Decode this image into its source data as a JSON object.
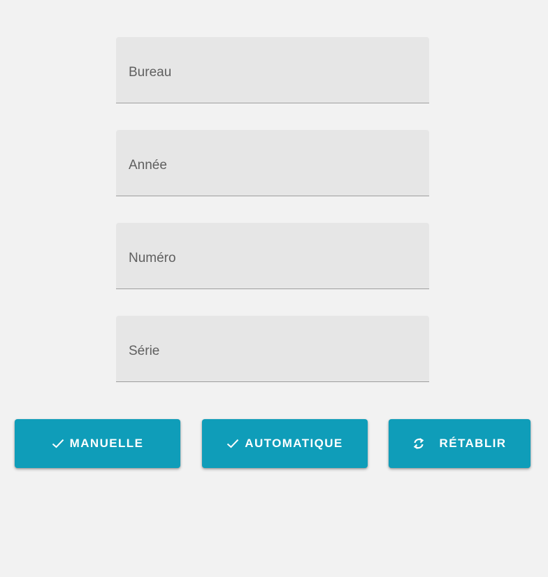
{
  "form": {
    "fields": [
      {
        "label": "Bureau",
        "value": ""
      },
      {
        "label": "Année",
        "value": ""
      },
      {
        "label": "Numéro",
        "value": ""
      },
      {
        "label": "Série",
        "value": ""
      }
    ]
  },
  "actions": {
    "manual": {
      "label": "MANUELLE",
      "icon": "check-icon"
    },
    "automatic": {
      "label": "AUTOMATIQUE",
      "icon": "check-icon"
    },
    "reset": {
      "label": "RÉTABLIR",
      "icon": "refresh-icon"
    }
  },
  "colors": {
    "background": "#f2f2f2",
    "field_background": "#e6e6e6",
    "field_underline": "#9e9e9e",
    "button_primary": "#0f9db9",
    "button_text": "#ffffff"
  }
}
